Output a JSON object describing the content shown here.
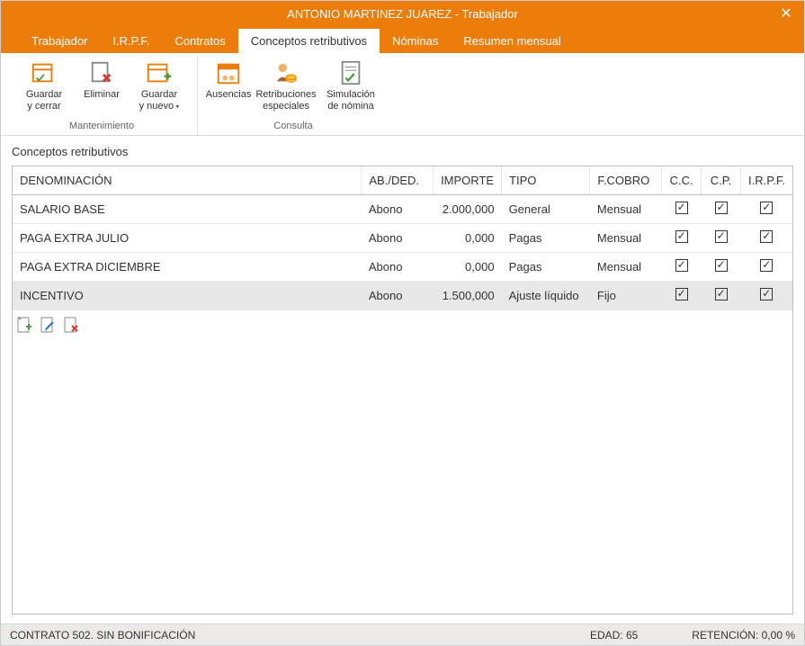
{
  "title": "ANTONIO MARTINEZ JUAREZ - Trabajador",
  "tabs": [
    {
      "label": "Trabajador",
      "active": false
    },
    {
      "label": "I.R.P.F.",
      "active": false
    },
    {
      "label": "Contratos",
      "active": false
    },
    {
      "label": "Conceptos retributivos",
      "active": true
    },
    {
      "label": "Nóminas",
      "active": false
    },
    {
      "label": "Resumen mensual",
      "active": false
    }
  ],
  "ribbon": {
    "groups": [
      {
        "label": "Mantenimiento",
        "buttons": [
          {
            "line1": "Guardar",
            "line2": "y cerrar",
            "icon": "save-close"
          },
          {
            "line1": "Eliminar",
            "line2": "",
            "icon": "delete"
          },
          {
            "line1": "Guardar",
            "line2": "y nuevo",
            "icon": "save-new",
            "dropdown": true
          }
        ]
      },
      {
        "label": "Consulta",
        "buttons": [
          {
            "line1": "Ausencias",
            "line2": "",
            "icon": "absences"
          },
          {
            "line1": "Retribuciones",
            "line2": "especiales",
            "icon": "special-pay"
          },
          {
            "line1": "Simulación",
            "line2": "de nómina",
            "icon": "simulate"
          }
        ]
      }
    ]
  },
  "section_title": "Conceptos retributivos",
  "columns": {
    "denom": "DENOMINACIÓN",
    "abded": "AB./DED.",
    "importe": "IMPORTE",
    "tipo": "TIPO",
    "fcobro": "F.COBRO",
    "cc": "C.C.",
    "cp": "C.P.",
    "irpf": "I.R.P.F."
  },
  "rows": [
    {
      "denom": "SALARIO BASE",
      "abded": "Abono",
      "importe": "2.000,000",
      "tipo": "General",
      "fcobro": "Mensual",
      "cc": true,
      "cp": true,
      "irpf": true,
      "selected": false
    },
    {
      "denom": "PAGA EXTRA JULIO",
      "abded": "Abono",
      "importe": "0,000",
      "tipo": "Pagas",
      "fcobro": "Mensual",
      "cc": true,
      "cp": true,
      "irpf": true,
      "selected": false
    },
    {
      "denom": "PAGA EXTRA DICIEMBRE",
      "abded": "Abono",
      "importe": "0,000",
      "tipo": "Pagas",
      "fcobro": "Mensual",
      "cc": true,
      "cp": true,
      "irpf": true,
      "selected": false
    },
    {
      "denom": "INCENTIVO",
      "abded": "Abono",
      "importe": "1.500,000",
      "tipo": "Ajuste líquido",
      "fcobro": "Fijo",
      "cc": true,
      "cp": true,
      "irpf": true,
      "selected": true
    }
  ],
  "row_actions": [
    "add",
    "edit",
    "delete"
  ],
  "status": {
    "left": "CONTRATO 502.  SIN BONIFICACIÓN",
    "mid": "EDAD: 65",
    "right": "RETENCIÓN: 0,00 %"
  }
}
